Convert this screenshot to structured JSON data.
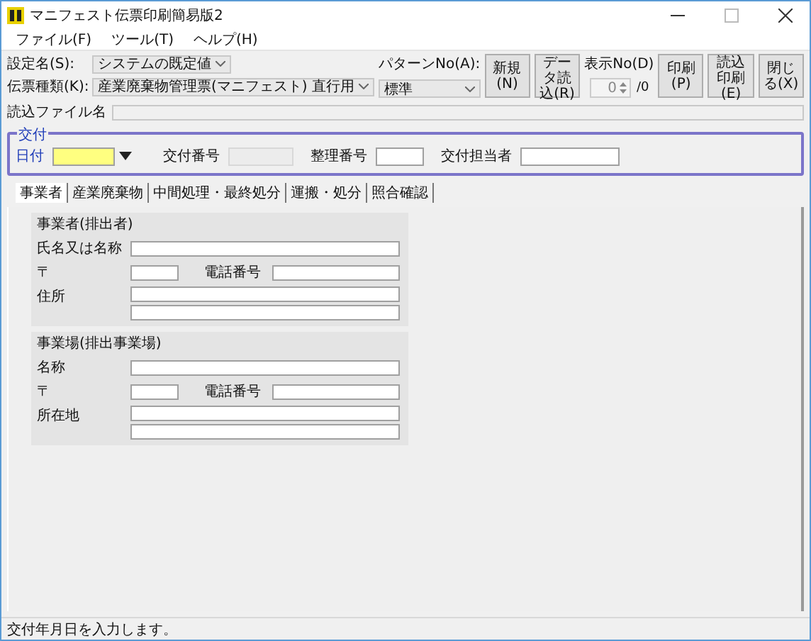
{
  "window": {
    "title": "マニフェスト伝票印刷簡易版2"
  },
  "menu": [
    {
      "label": "ファイル(F)"
    },
    {
      "label": "ツール(T)"
    },
    {
      "label": "ヘルプ(H)"
    }
  ],
  "settings": [
    {
      "label": "設定名(S):",
      "value": "システムの既定値"
    },
    {
      "label": "伝票種類(K):",
      "value": "産業廃棄物管理票(マニフェスト) 直行用"
    }
  ],
  "pattern": {
    "label": "パターンNo(A):",
    "value": "標準"
  },
  "display_no": {
    "label": "表示No(D)",
    "value": "0",
    "total": "/0"
  },
  "buttons_left": [
    {
      "label": "新規(N)"
    },
    {
      "label": "データ読込(R)"
    }
  ],
  "buttons_right": [
    {
      "label": "印刷(P)"
    },
    {
      "label": "読込印刷(E)"
    },
    {
      "label": "閉じる(X)"
    }
  ],
  "file": {
    "label": "読込ファイル名"
  },
  "issue": {
    "title": "交付",
    "date_label": "日付",
    "date_focused": true,
    "fields": [
      {
        "label": "交付番号",
        "disabled": true
      },
      {
        "label": "整理番号",
        "disabled": false
      },
      {
        "label": "交付担当者",
        "disabled": false
      }
    ]
  },
  "tabs": [
    {
      "label": "事業者",
      "selected": true
    },
    {
      "label": "産業廃棄物",
      "selected": false
    },
    {
      "label": "中間処理・最終処分",
      "selected": false
    },
    {
      "label": "運搬・処分",
      "selected": false
    },
    {
      "label": "照合確認",
      "selected": false
    }
  ],
  "sections": [
    {
      "title": "事業者(排出者)",
      "rows": [
        {
          "kind": "wide",
          "label": "氏名又は名称"
        },
        {
          "kind": "postal",
          "label": "〒",
          "phone_label": "電話番号"
        },
        {
          "kind": "double",
          "label": "住所"
        }
      ]
    },
    {
      "title": "事業場(排出事業場)",
      "rows": [
        {
          "kind": "wide",
          "label": "名称"
        },
        {
          "kind": "postal",
          "label": "〒",
          "phone_label": "電話番号"
        },
        {
          "kind": "double",
          "label": "所在地"
        }
      ]
    }
  ],
  "status_bar": "交付年月日を入力します。"
}
